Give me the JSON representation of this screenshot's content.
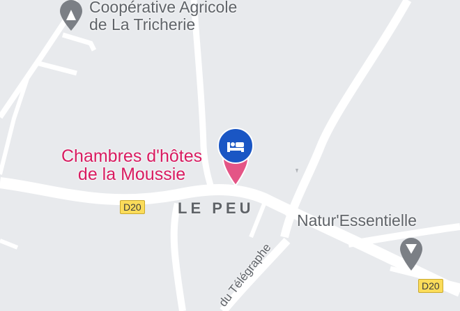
{
  "map": {
    "pois": {
      "cooperative": {
        "line1": "Coopérative Agricole",
        "line2": "de La Tricherie",
        "icon": "location-pin-icon"
      },
      "chambres": {
        "line1": "Chambres d'hôtes",
        "line2": "de la Moussie",
        "icon": "hotel-bed-icon"
      },
      "natur": {
        "label": "Natur'Essentielle",
        "icon": "location-pin-icon"
      }
    },
    "locality": "LE PEU",
    "routes": {
      "left": "D20",
      "right": "D20"
    },
    "street": "du Télégraphe",
    "colors": {
      "background": "#e8eaed",
      "road": "#ffffff",
      "poi_pink": "#d81b60",
      "poi_grey": "#5f6368",
      "hotel_marker": "#1a56c4",
      "route_shield": "#fbdc5a"
    }
  }
}
